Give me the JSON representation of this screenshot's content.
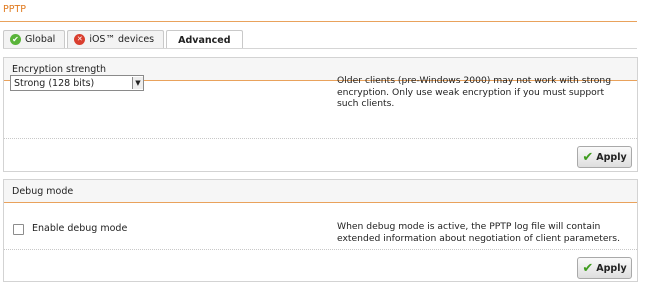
{
  "page": {
    "title": "PPTP"
  },
  "tabs": [
    {
      "label": "Global",
      "icon": "check-circle-icon",
      "status_color": "#5ab43a"
    },
    {
      "label": "iOS™ devices",
      "icon": "error-circle-icon",
      "status_color": "#d93e2e"
    },
    {
      "label": "Advanced",
      "active": true
    }
  ],
  "encryption": {
    "heading": "Encryption strength",
    "selected": "Strong (128 bits)",
    "help": "Older clients (pre-Windows 2000) may not work with strong encryption. Only use weak encryption if you must support such clients.",
    "apply_label": "Apply"
  },
  "debug": {
    "heading": "Debug mode",
    "checkbox_label": "Enable debug mode",
    "checked": false,
    "help": "When debug mode is active, the PPTP log file will contain extended information about negotiation of client parameters.",
    "apply_label": "Apply"
  },
  "colors": {
    "accent": "#e07a1f",
    "ok": "#5ab43a",
    "error": "#d93e2e"
  }
}
